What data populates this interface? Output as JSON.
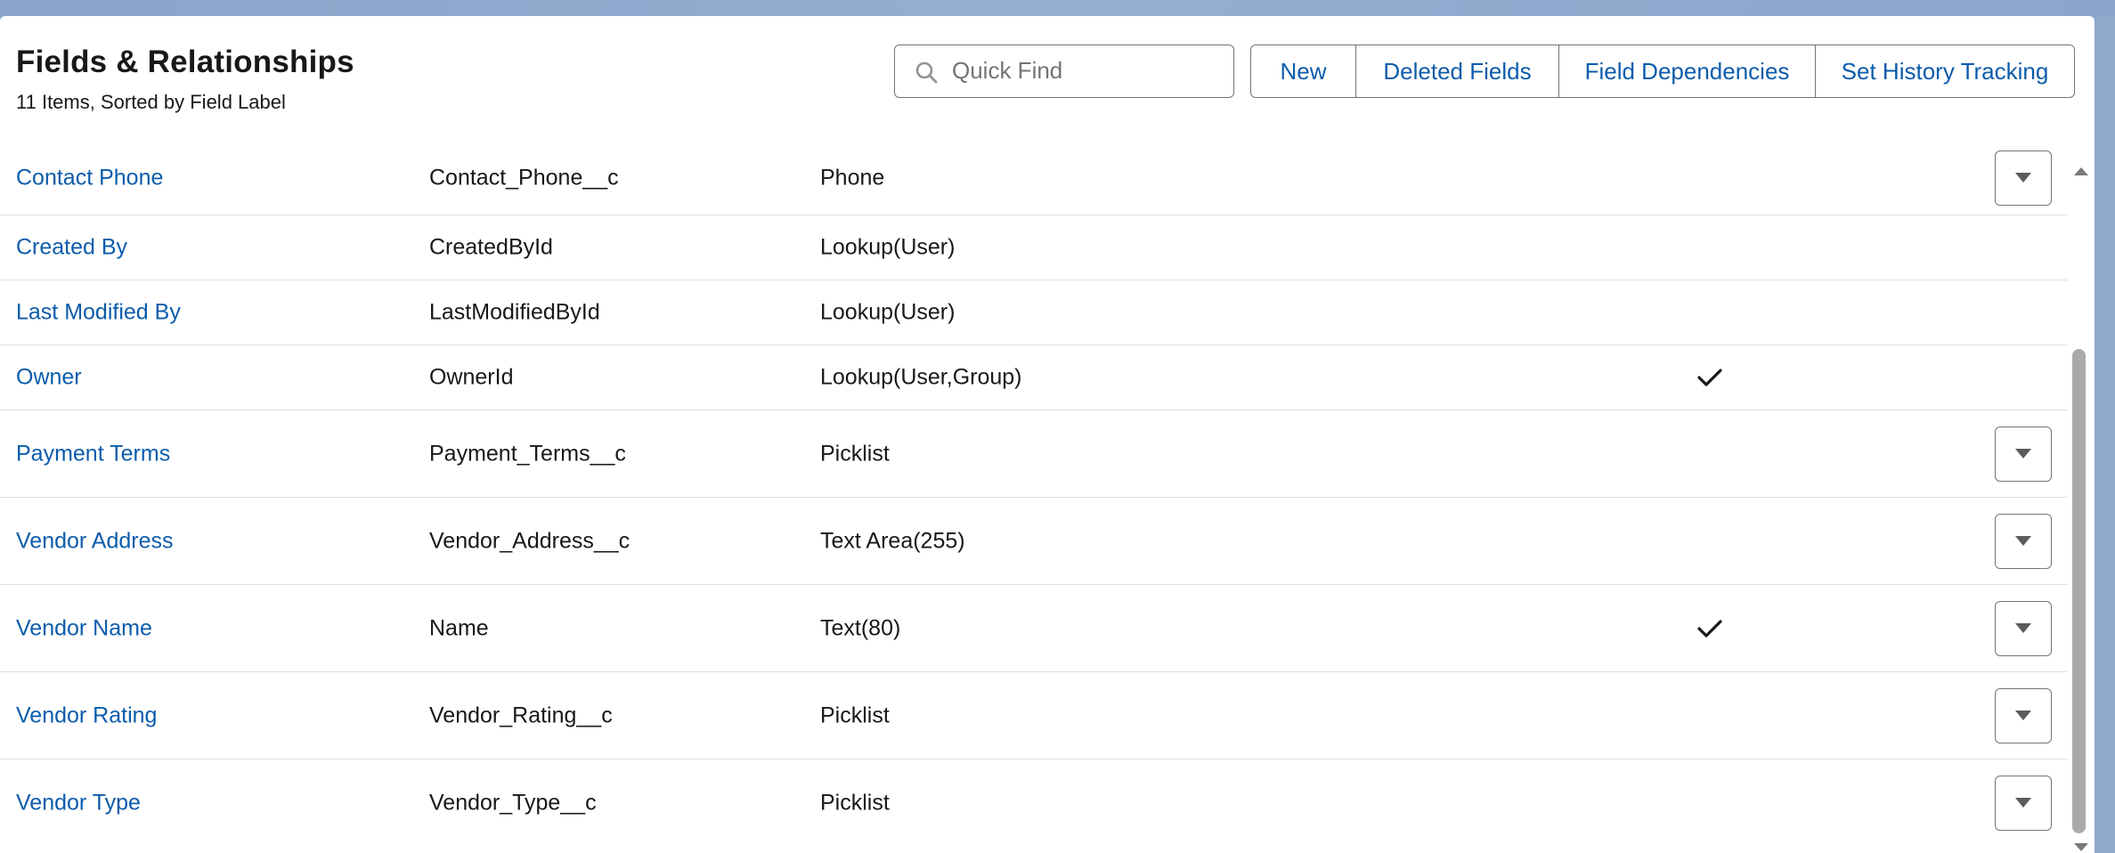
{
  "header": {
    "title": "Fields & Relationships",
    "subtitle": "11 Items, Sorted by Field Label"
  },
  "search": {
    "placeholder": "Quick Find",
    "icon": "search-icon"
  },
  "toolbar": {
    "new_label": "New",
    "deleted_label": "Deleted Fields",
    "dependencies_label": "Field Dependencies",
    "history_label": "Set History Tracking"
  },
  "colors": {
    "link": "#0b5cab",
    "text": "#181818",
    "border": "#747474",
    "row_divider": "#e0e0e0",
    "background": "#8fa8cc"
  },
  "rows": [
    {
      "label": "Contact Phone",
      "api_name": "Contact_Phone__c",
      "type": "Phone",
      "indexed": false,
      "has_menu": true
    },
    {
      "label": "Created By",
      "api_name": "CreatedById",
      "type": "Lookup(User)",
      "indexed": false,
      "has_menu": false
    },
    {
      "label": "Last Modified By",
      "api_name": "LastModifiedById",
      "type": "Lookup(User)",
      "indexed": false,
      "has_menu": false
    },
    {
      "label": "Owner",
      "api_name": "OwnerId",
      "type": "Lookup(User,Group)",
      "indexed": true,
      "has_menu": false
    },
    {
      "label": "Payment Terms",
      "api_name": "Payment_Terms__c",
      "type": "Picklist",
      "indexed": false,
      "has_menu": true
    },
    {
      "label": "Vendor Address",
      "api_name": "Vendor_Address__c",
      "type": "Text Area(255)",
      "indexed": false,
      "has_menu": true
    },
    {
      "label": "Vendor Name",
      "api_name": "Name",
      "type": "Text(80)",
      "indexed": true,
      "has_menu": true
    },
    {
      "label": "Vendor Rating",
      "api_name": "Vendor_Rating__c",
      "type": "Picklist",
      "indexed": false,
      "has_menu": true
    },
    {
      "label": "Vendor Type",
      "api_name": "Vendor_Type__c",
      "type": "Picklist",
      "indexed": false,
      "has_menu": true
    }
  ]
}
